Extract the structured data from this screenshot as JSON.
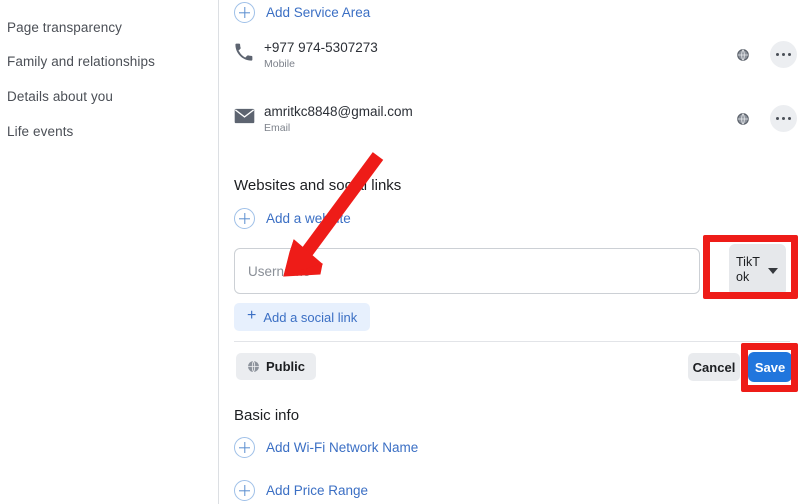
{
  "sidebar": {
    "items": [
      {
        "label": "Page transparency"
      },
      {
        "label": "Family and relationships"
      },
      {
        "label": "Details about you"
      },
      {
        "label": "Life events"
      }
    ]
  },
  "main": {
    "add_service_area": {
      "label": "Add Service Area",
      "icon": "plus-circle-icon"
    },
    "contacts": [
      {
        "icon": "phone-icon",
        "value": "+977 974-5307273",
        "sub_label": "Mobile",
        "privacy_icon": "globe-icon",
        "menu_icon": "ellipsis-icon"
      },
      {
        "icon": "envelope-icon",
        "value": "amritkc8848@gmail.com",
        "sub_label": "Email",
        "privacy_icon": "globe-icon",
        "menu_icon": "ellipsis-icon"
      }
    ],
    "websites_section": {
      "title": "Websites and social links",
      "add_website": {
        "label": "Add a website",
        "icon": "plus-circle-icon"
      },
      "username_field": {
        "value": "",
        "placeholder": "Username"
      },
      "platform_select": {
        "selected": "TikTok",
        "caret_icon": "chevron-down-icon"
      },
      "add_social_link": {
        "label": "Add a social link",
        "icon": "plus-icon"
      },
      "audience_button": {
        "label": "Public",
        "icon": "globe-icon"
      },
      "cancel_button": {
        "label": "Cancel"
      },
      "save_button": {
        "label": "Save"
      }
    },
    "basic_info": {
      "title": "Basic info",
      "items": [
        {
          "label": "Add Wi-Fi Network Name",
          "icon": "plus-circle-icon"
        },
        {
          "label": "Add Price Range",
          "icon": "plus-circle-icon"
        }
      ]
    }
  },
  "annotations": {
    "color": "#ee1c18",
    "arrow": {
      "name": "red-arrow-pointer"
    },
    "boxes": [
      {
        "name": "platform-select-highlight"
      },
      {
        "name": "save-button-highlight"
      }
    ]
  }
}
